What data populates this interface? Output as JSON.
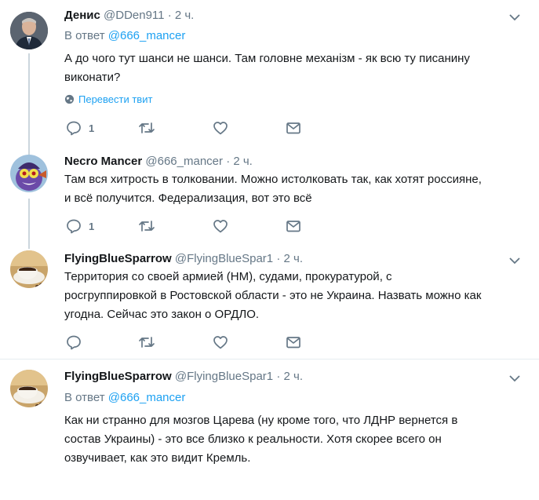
{
  "tweets": [
    {
      "name": "Денис",
      "handle": "@DDen911",
      "sep": "·",
      "time": "2 ч.",
      "reply_prefix": "В ответ",
      "reply_mention": "@666_mancer",
      "text_lines": [
        "А до чого тут шанси не шанси. Там головне механізм - як всю ту писанину",
        "виконати?"
      ],
      "translate_label": "Перевести твит",
      "reply_count": "1"
    },
    {
      "name": "Necro Mancer",
      "handle": "@666_mancer",
      "sep": "·",
      "time": "2 ч.",
      "text_lines": [
        "Там вся хитрость в толковании. Можно истолковать так, как хотят россияне,",
        "и всё получится. Федерализация, вот это всё"
      ],
      "reply_count": "1"
    },
    {
      "name": "FlyingBlueSparrow",
      "handle": "@FlyingBlueSpar1",
      "sep": "·",
      "time": "2 ч.",
      "text_lines": [
        "Территория со своей армией (НМ), судами, прокуратурой, с",
        "росгруппировкой в Ростовской области - это не Украина. Назвать можно как",
        "угодна. Сейчас это закон о ОРДЛО."
      ]
    },
    {
      "name": "FlyingBlueSparrow",
      "handle": "@FlyingBlueSpar1",
      "sep": "·",
      "time": "2 ч.",
      "reply_prefix": "В ответ",
      "reply_mention": "@666_mancer",
      "text_lines": [
        "Как ни странно для мозгов Царева (ну кроме того, что ЛДНР вернется в",
        "состав Украины) - это все близко к реальности. Хотя скорее всего он",
        "озвучивает, как это видит Кремль."
      ]
    }
  ],
  "icons": {
    "reply": "reply-icon",
    "retweet": "retweet-icon",
    "like": "like-icon",
    "message": "direct-message-icon",
    "caret": "chevron-down-icon",
    "globe": "globe-icon"
  },
  "colors": {
    "accent": "#1da1f2",
    "secondary_text": "#657786",
    "thread_line": "#ccd6dd",
    "divider": "#e6ecf0"
  }
}
